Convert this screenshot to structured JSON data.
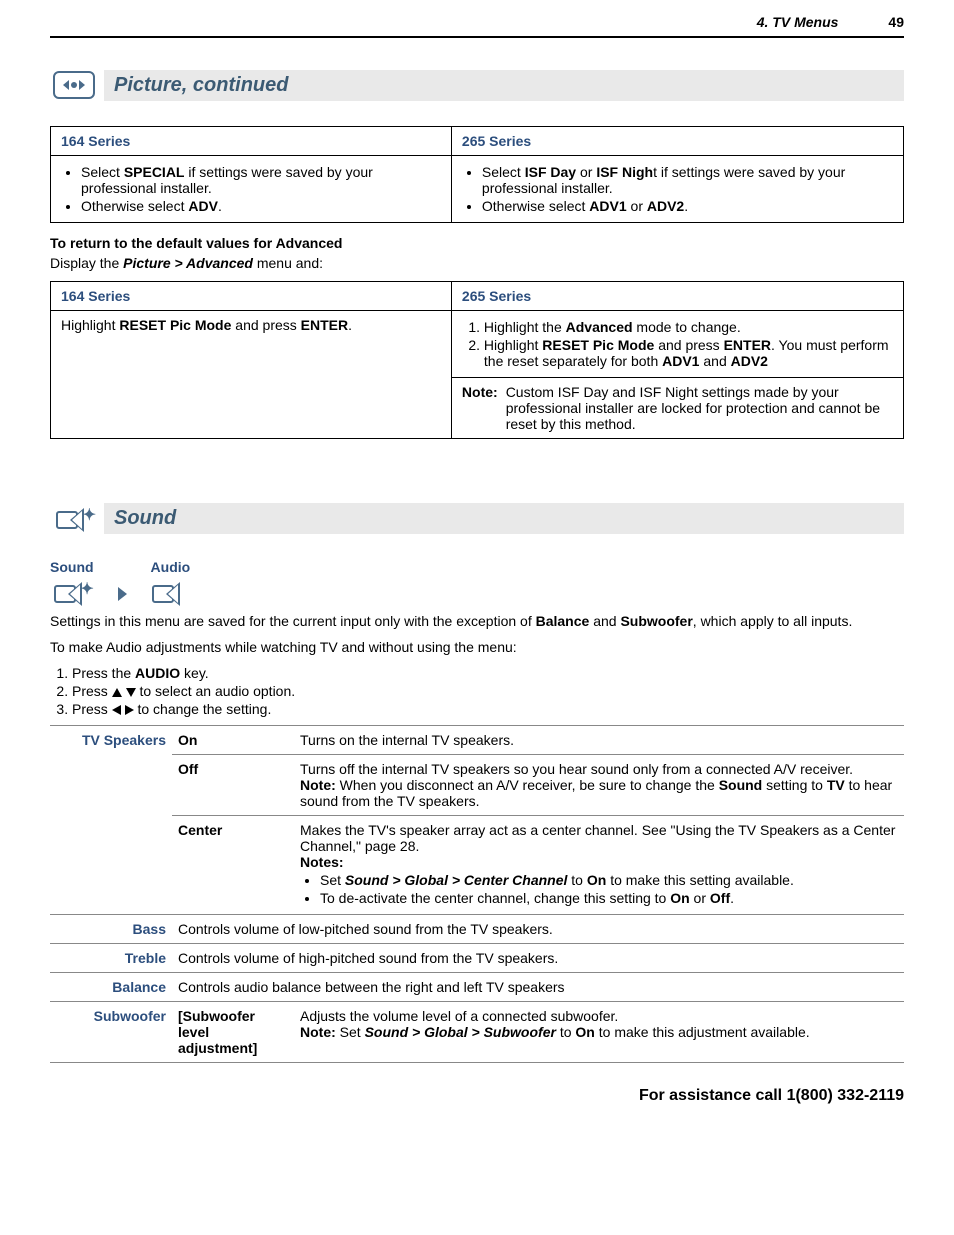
{
  "header": {
    "chapter": "4.  TV Menus",
    "page": "49"
  },
  "section_picture": {
    "title": "Picture, continued"
  },
  "table1": {
    "col1_header": "164 Series",
    "col2_header": "265 Series",
    "col1_b1_pre": "Select ",
    "col1_b1_kw": "SPECIAL",
    "col1_b1_post": " if settings were saved by your professional installer.",
    "col1_b2_pre": "Otherwise select ",
    "col1_b2_kw": "ADV",
    "col1_b2_post": ".",
    "col2_b1_pre": "Select ",
    "col2_b1_kw1": "ISF Day",
    "col2_b1_or": " or ",
    "col2_b1_kw2": "ISF Nigh",
    "col2_b1_post": "t if settings were saved by your professional installer.",
    "col2_b2_pre": "Otherwise select ",
    "col2_b2_kw1": "ADV1",
    "col2_b2_or": " or ",
    "col2_b2_kw2": "ADV2",
    "col2_b2_post": "."
  },
  "reset_heading": "To return to the default values for Advanced",
  "reset_para_pre": "Display the ",
  "reset_para_menu": "Picture > Advanced",
  "reset_para_post": " menu and:",
  "table2": {
    "col1_header": "164 Series",
    "col2_header": "265 Series",
    "col1_text_pre": "Highlight ",
    "col1_text_kw1": "RESET Pic Mode",
    "col1_text_mid": " and press ",
    "col1_text_kw2": "ENTER",
    "col1_text_post": ".",
    "ol1_pre": "Highlight the ",
    "ol1_kw": "Advanced",
    "ol1_post": " mode to change.",
    "ol2_pre": "Highlight ",
    "ol2_kw1": "RESET Pic Mode",
    "ol2_mid": " and press ",
    "ol2_kw2": "ENTER",
    "ol2_post1": ".  You must perform the reset separately for both ",
    "ol2_kw3": "ADV1",
    "ol2_and": " and ",
    "ol2_kw4": "ADV2",
    "note_label": "Note:",
    "note_text": "Custom ISF Day and ISF Night settings made by your professional installer are locked for protection and cannot be reset by this method."
  },
  "section_sound": {
    "title": "Sound"
  },
  "breadcrumb": {
    "sound": "Sound",
    "audio": "Audio"
  },
  "sound_intro_pre": "Settings in this menu are saved for the current input only with the exception of ",
  "sound_intro_kw1": "Balance",
  "sound_intro_and": " and ",
  "sound_intro_kw2": "Subwoofer",
  "sound_intro_post": ", which apply to all inputs.",
  "sound_adjust_intro": "To make Audio adjustments while watching TV and without using the menu:",
  "steps": {
    "s1_pre": "Press the ",
    "s1_kw": "AUDIO",
    "s1_post": " key.",
    "s2_pre": "Press ",
    "s2_post": " to select an audio option.",
    "s3_pre": "Press ",
    "s3_post": " to change the setting."
  },
  "audio_table": {
    "tvspeakers": "TV Speakers",
    "on": "On",
    "on_desc": "Turns on the internal TV speakers.",
    "off": "Off",
    "off_desc_pre": "Turns off the internal TV speakers so you hear sound only from a connected A/V receiver.  ",
    "off_note_label": "Note:",
    "off_note_body_pre": "  When you disconnect an A/V receiver, be sure to change the ",
    "off_note_kw1": "Sound",
    "off_note_mid": " setting to ",
    "off_note_kw2": "TV",
    "off_note_post": " to hear sound from the TV speakers.",
    "center": "Center",
    "center_desc": "Makes the TV's speaker array act as a center channel.  See \"Using the TV Speakers as a Center Channel,\" page 28.",
    "center_notes_label": "Notes:",
    "center_b1_pre": "Set ",
    "center_b1_path": "Sound > Global > Center Channel",
    "center_b1_mid": " to ",
    "center_b1_on": "On",
    "center_b1_post": " to make this setting available.",
    "center_b2_pre": "To de-activate the center channel, change this setting to ",
    "center_b2_on": "On",
    "center_b2_or": " or ",
    "center_b2_off": "Off",
    "center_b2_post": ".",
    "bass": "Bass",
    "bass_desc": "Controls volume of low-pitched sound from the TV speakers.",
    "treble": "Treble",
    "treble_desc": "Controls volume of high-pitched sound from the TV speakers.",
    "balance": "Balance",
    "balance_desc": "Controls audio balance between the right and left TV speakers",
    "subwoofer": "Subwoofer",
    "sub_opt": "[Subwoofer level adjustment]",
    "sub_desc": "Adjusts the volume level of a connected subwoofer.",
    "sub_note_label": "Note:",
    "sub_note_pre": "  Set ",
    "sub_note_path": "Sound > Global > Subwoofer",
    "sub_note_mid": " to ",
    "sub_note_on": "On",
    "sub_note_post": " to make this adjustment available."
  },
  "footer": "For assistance call 1(800) 332-2119"
}
